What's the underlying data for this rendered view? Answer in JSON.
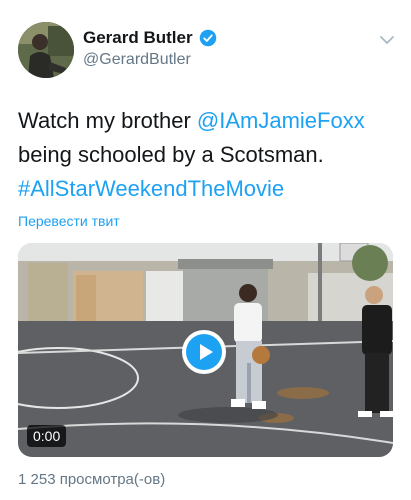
{
  "author": {
    "name": "Gerard Butler",
    "handle": "@GerardButler",
    "verified_icon": "verified-badge-icon",
    "avatar_icon": "avatar"
  },
  "tweet": {
    "text_part1": "Watch my brother ",
    "mention": "@IAmJamieFoxx",
    "text_part2": " being schooled by a Scotsman. ",
    "hashtag": "#AllStarWeekendTheMovie"
  },
  "translate_label": "Перевести твит",
  "video": {
    "duration": "0:00",
    "play_icon": "play-icon"
  },
  "views": "1 253 просмотра(-ов)",
  "colors": {
    "link": "#1da1f2",
    "secondary_text": "#657786",
    "primary_text": "#14171a"
  }
}
